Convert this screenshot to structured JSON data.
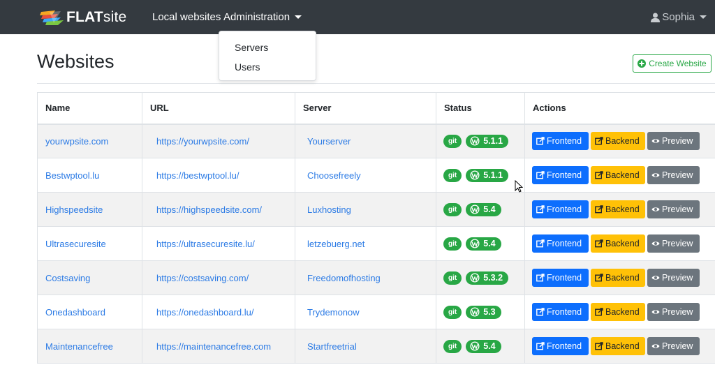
{
  "navbar": {
    "brand_bold": "FLAT",
    "brand_light": "site",
    "local_websites": "Local websites",
    "administration": "Administration",
    "user": "Sophia"
  },
  "dropdown": {
    "items": [
      "Servers",
      "Users"
    ]
  },
  "page": {
    "title": "Websites",
    "create_button": "Create Website"
  },
  "table": {
    "headers": {
      "name": "Name",
      "url": "URL",
      "server": "Server",
      "status": "Status",
      "actions": "Actions"
    },
    "rows": [
      {
        "name": "yourwpsite.com",
        "url": "https://yourwpsite.com/",
        "server": "Yourserver",
        "git": "git",
        "wp_version": "5.1.1"
      },
      {
        "name": "Bestwptool.lu",
        "url": "https://bestwptool.lu/",
        "server": "Choosefreely",
        "git": "git",
        "wp_version": "5.1.1"
      },
      {
        "name": "Highspeedsite",
        "url": "https://highspeedsite.com/",
        "server": "Luxhosting",
        "git": "git",
        "wp_version": "5.4"
      },
      {
        "name": "Ultrasecuresite",
        "url": "https://ultrasecuresite.lu/",
        "server": "letzebuerg.net",
        "git": "git",
        "wp_version": "5.4"
      },
      {
        "name": "Costsaving",
        "url": "https://costsaving.com/",
        "server": "Freedomofhosting",
        "git": "git",
        "wp_version": "5.3.2"
      },
      {
        "name": "Onedashboard",
        "url": "https://onedashboard.lu/",
        "server": "Trydemonow",
        "git": "git",
        "wp_version": "5.3"
      },
      {
        "name": "Maintenancefree",
        "url": "https://maintenancefree.com",
        "server": "Startfreetrial",
        "git": "git",
        "wp_version": "5.4"
      }
    ],
    "actions": {
      "frontend": "Frontend",
      "backend": "Backend",
      "preview": "Preview"
    }
  },
  "colors": {
    "navbar_bg": "#343a40",
    "link": "#2c7be5",
    "success": "#28a745",
    "primary": "#0d6efd",
    "warning": "#ffc107",
    "secondary": "#6c757d"
  },
  "icons": {
    "brand": "flatsite-logo-icon",
    "user": "user-icon",
    "create": "plus-circle-icon",
    "wordpress": "wordpress-icon",
    "external": "external-link-icon",
    "preview": "eye-icon"
  }
}
